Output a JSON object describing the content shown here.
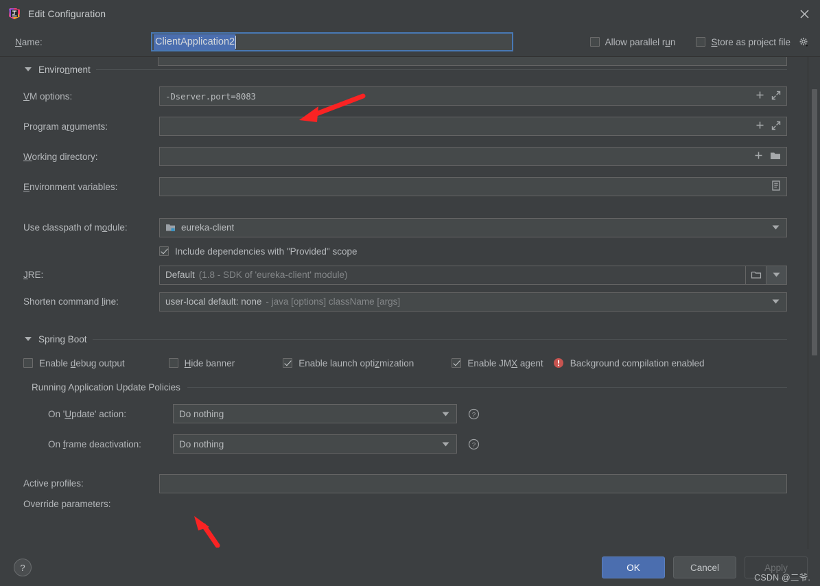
{
  "window": {
    "title": "Edit Configuration",
    "app_icon": "intellij-idea-logo",
    "close_icon": "close-icon"
  },
  "name_row": {
    "label": "Name:",
    "label_mnemonic": "N",
    "value": "ClientApplication2",
    "options": [
      {
        "label": "Allow parallel run",
        "checked": false,
        "mnemonic": "u"
      },
      {
        "label": "Store as project file",
        "checked": false,
        "mnemonic": "S"
      }
    ],
    "gear_icon": "gear-icon"
  },
  "environment": {
    "section_title": "Environment",
    "collapsed": false,
    "rows": [
      {
        "label": "VM options:",
        "value": "-Dserver.port=8083",
        "placeholder": "",
        "icons": [
          "plus-icon",
          "expand-icon"
        ]
      },
      {
        "label": "Program arguments:",
        "value": "",
        "placeholder": "",
        "icons": [
          "plus-icon",
          "expand-icon"
        ]
      },
      {
        "label": "Working directory:",
        "value": "",
        "placeholder": "",
        "icons": [
          "plus-icon",
          "folder-icon"
        ]
      },
      {
        "label": "Environment variables:",
        "value": "",
        "placeholder": "",
        "icons": [
          "list-icon"
        ]
      }
    ]
  },
  "classpath": {
    "module_label": "Use classpath of module:",
    "module_value": "eureka-client",
    "module_icon": "module-icon",
    "include_deps": {
      "label": "Include dependencies with \"Provided\" scope",
      "checked": true
    },
    "jre_label": "JRE:",
    "jre_value": "Default",
    "jre_hint": "(1.8 - SDK of 'eureka-client' module)",
    "shorten_label": "Shorten command line:",
    "shorten_value": "user-local default: none",
    "shorten_hint": "- java [options] className [args]"
  },
  "spring_boot": {
    "section_title": "Spring Boot",
    "collapsed": false,
    "checkboxes": [
      {
        "label": "Enable debug output",
        "checked": false
      },
      {
        "label": "Hide banner",
        "checked": false
      },
      {
        "label": "Enable launch optimization",
        "checked": true
      },
      {
        "label": "Enable JMX agent",
        "checked": true
      }
    ],
    "warning": {
      "icon": "error-icon",
      "text": "Background compilation enabled",
      "color": "#c75450"
    },
    "update_policies": {
      "title": "Running Application Update Policies",
      "rows": [
        {
          "label": "On 'Update' action:",
          "value": "Do nothing",
          "help_icon": "help-icon"
        },
        {
          "label": "On frame deactivation:",
          "value": "Do nothing",
          "help_icon": "help-icon"
        }
      ]
    },
    "active_profiles_label": "Active profiles:",
    "active_profiles_value": "",
    "override_parameters_label": "Override parameters:"
  },
  "footer": {
    "help_label": "?",
    "ok_label": "OK",
    "cancel_label": "Cancel",
    "apply_label": "Apply",
    "apply_enabled": false,
    "watermark": "CSDN @二爷."
  },
  "colors": {
    "background": "#3c3f41",
    "field_background": "#45494a",
    "accent_blue": "#4b6eaf",
    "text": "#b4b7ba",
    "annotation_red": "#ff2020",
    "error_red": "#c75450"
  }
}
